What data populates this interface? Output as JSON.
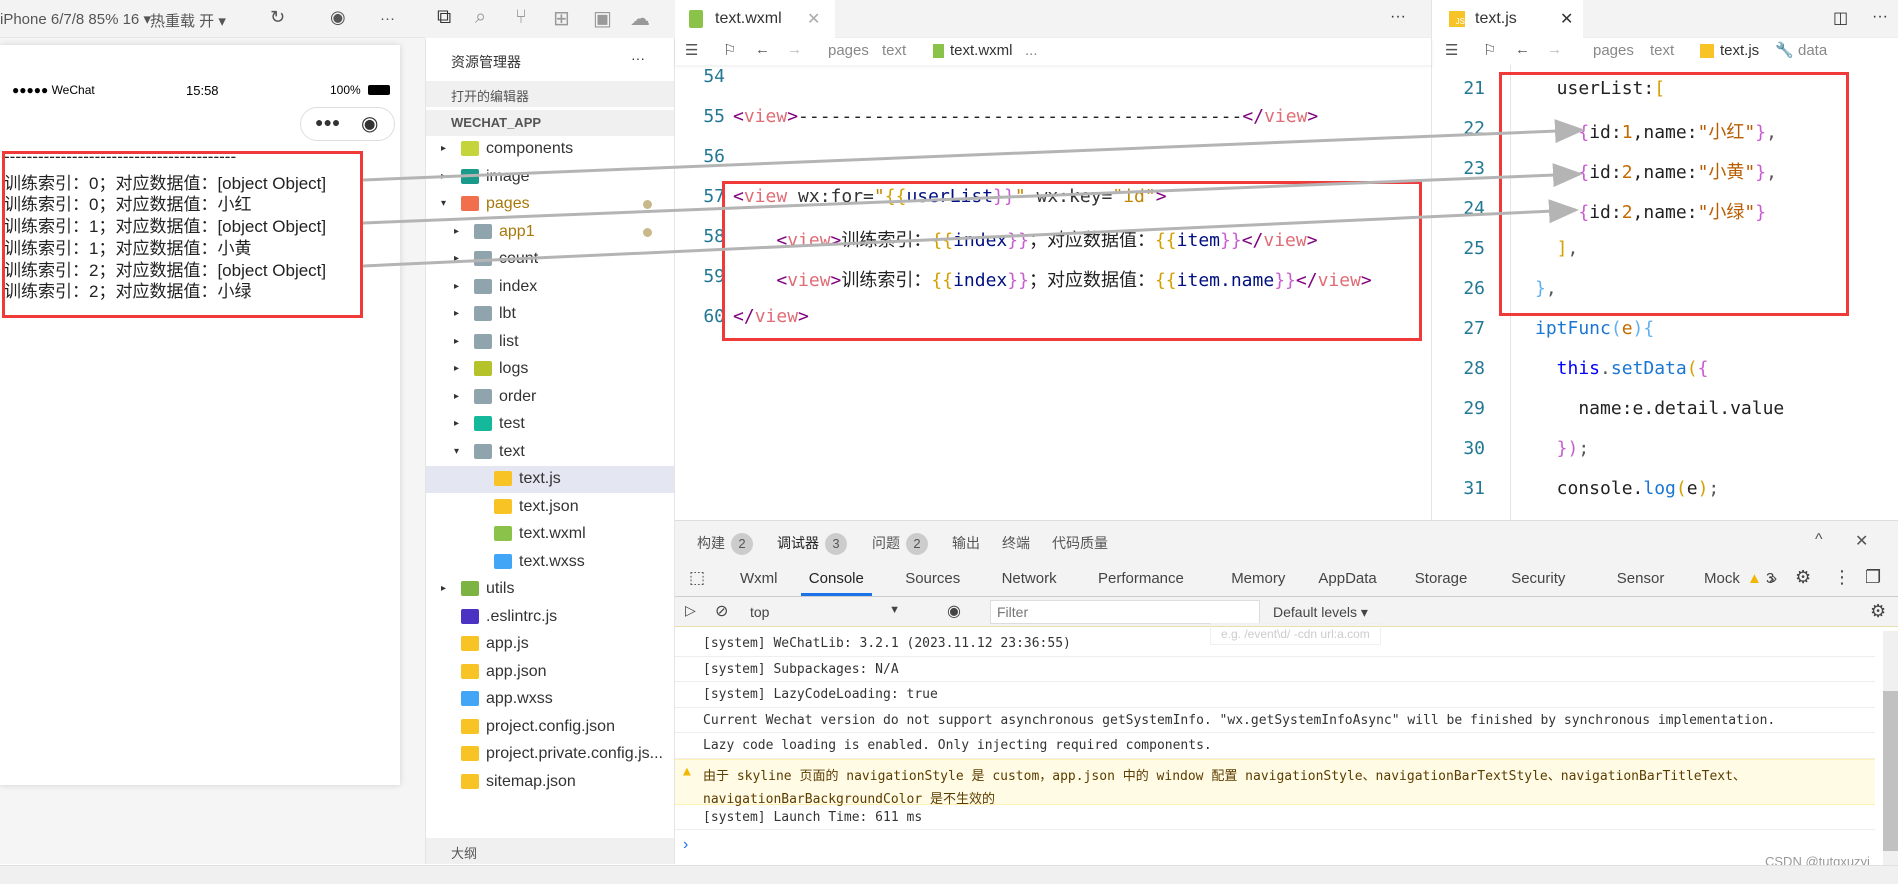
{
  "simulator": {
    "device": "iPhone 6/7/8 85% 16 ▾",
    "hot_reload": "热重载 开 ▾",
    "status": {
      "carrier": "●●●●● WeChat",
      "time": "15:58",
      "battery": "100%"
    },
    "lines": [
      "-----------------------------------------",
      "训练索引：0；对应数据值：[object Object]",
      "训练索引：0；对应数据值：小红",
      "训练索引：1；对应数据值：[object Object]",
      "训练索引：1；对应数据值：小黄",
      "训练索引：2；对应数据值：[object Object]",
      "训练索引：2；对应数据值：小绿"
    ]
  },
  "explorer": {
    "title": "资源管理器",
    "more": "···",
    "open_editors": "打开的编辑器",
    "project": "WECHAT_APP",
    "outline": "大纲",
    "items": [
      {
        "label": "components",
        "depth": 0,
        "arrow": "▸",
        "icon": "folder-components",
        "color": "#c6d43c"
      },
      {
        "label": "image",
        "depth": 0,
        "arrow": "▸",
        "icon": "folder-image",
        "color": "#1a9a8a"
      },
      {
        "label": "pages",
        "depth": 0,
        "arrow": "▾",
        "icon": "folder-pages",
        "color": "#f26f4d",
        "modified": true,
        "labelColor": "#a8780a"
      },
      {
        "label": "app1",
        "depth": 1,
        "arrow": "▸",
        "icon": "folder",
        "color": "#90a4ae",
        "modified": true,
        "labelColor": "#a8780a"
      },
      {
        "label": "count",
        "depth": 1,
        "arrow": "▸",
        "icon": "folder",
        "color": "#90a4ae"
      },
      {
        "label": "index",
        "depth": 1,
        "arrow": "▸",
        "icon": "folder",
        "color": "#90a4ae"
      },
      {
        "label": "lbt",
        "depth": 1,
        "arrow": "▸",
        "icon": "folder",
        "color": "#90a4ae"
      },
      {
        "label": "list",
        "depth": 1,
        "arrow": "▸",
        "icon": "folder",
        "color": "#90a4ae"
      },
      {
        "label": "logs",
        "depth": 1,
        "arrow": "▸",
        "icon": "folder-logs",
        "color": "#b5c22a"
      },
      {
        "label": "order",
        "depth": 1,
        "arrow": "▸",
        "icon": "folder",
        "color": "#90a4ae"
      },
      {
        "label": "test",
        "depth": 1,
        "arrow": "▸",
        "icon": "folder-test",
        "color": "#14b89a"
      },
      {
        "label": "text",
        "depth": 1,
        "arrow": "▾",
        "icon": "folder-open",
        "color": "#90a4ae"
      },
      {
        "label": "text.js",
        "depth": 2,
        "icon": "js-file",
        "color": "#f7c325",
        "selected": true
      },
      {
        "label": "text.json",
        "depth": 2,
        "icon": "json-file",
        "color": "#f7c325"
      },
      {
        "label": "text.wxml",
        "depth": 2,
        "icon": "wxml-file",
        "color": "#8bc34a"
      },
      {
        "label": "text.wxss",
        "depth": 2,
        "icon": "wxss-file",
        "color": "#42a5f5"
      },
      {
        "label": "utils",
        "depth": 0,
        "arrow": "▸",
        "icon": "folder-utils",
        "color": "#7cb342"
      },
      {
        "label": ".eslintrc.js",
        "depth": 0,
        "icon": "eslint-file",
        "color": "#4b32c3"
      },
      {
        "label": "app.js",
        "depth": 0,
        "icon": "js-file",
        "color": "#f7c325"
      },
      {
        "label": "app.json",
        "depth": 0,
        "icon": "json-file",
        "color": "#f7c325"
      },
      {
        "label": "app.wxss",
        "depth": 0,
        "icon": "wxss-file",
        "color": "#42a5f5"
      },
      {
        "label": "project.config.json",
        "depth": 0,
        "icon": "json-file",
        "color": "#f7c325"
      },
      {
        "label": "project.private.config.js...",
        "depth": 0,
        "icon": "json-file",
        "color": "#f7c325"
      },
      {
        "label": "sitemap.json",
        "depth": 0,
        "icon": "json-file",
        "color": "#f7c325"
      }
    ]
  },
  "editor1": {
    "tab": "text.wxml",
    "crumbs": [
      "pages",
      "text",
      "text.wxml",
      "..."
    ],
    "lines": [
      {
        "n": "54",
        "tokens": []
      },
      {
        "n": "55",
        "tokens": [
          {
            "t": "<",
            "c": "tag"
          },
          {
            "t": "view",
            "c": "tn"
          },
          {
            "t": ">",
            "c": "tag"
          },
          {
            "t": "-----------------------------------------",
            "c": "txt"
          },
          {
            "t": "</",
            "c": "tag"
          },
          {
            "t": "view",
            "c": "tn"
          },
          {
            "t": ">",
            "c": "tag"
          }
        ]
      },
      {
        "n": "56",
        "tokens": []
      },
      {
        "n": "57",
        "tokens": [
          {
            "t": "<",
            "c": "tag"
          },
          {
            "t": "view",
            "c": "tn"
          },
          {
            "t": " wx:for=",
            "c": "at"
          },
          {
            "t": "\"",
            "c": "str"
          },
          {
            "t": "{{",
            "c": "br"
          },
          {
            "t": "userList",
            "c": "id"
          },
          {
            "t": "}}",
            "c": "br2"
          },
          {
            "t": "\"",
            "c": "str"
          },
          {
            "t": " wx:key=",
            "c": "at"
          },
          {
            "t": "\"id\"",
            "c": "str"
          },
          {
            "t": ">",
            "c": "tag"
          }
        ]
      },
      {
        "n": "58",
        "tokens": [
          {
            "t": "    <",
            "c": "tag"
          },
          {
            "t": "view",
            "c": "tn"
          },
          {
            "t": ">",
            "c": "tag"
          },
          {
            "t": "训练索引：",
            "c": "txt"
          },
          {
            "t": "{{",
            "c": "br"
          },
          {
            "t": "index",
            "c": "id"
          },
          {
            "t": "}}",
            "c": "br2"
          },
          {
            "t": "；对应数据值：",
            "c": "txt"
          },
          {
            "t": "{{",
            "c": "br"
          },
          {
            "t": "item",
            "c": "id"
          },
          {
            "t": "}}",
            "c": "br2"
          },
          {
            "t": "</",
            "c": "tag"
          },
          {
            "t": "view",
            "c": "tn"
          },
          {
            "t": ">",
            "c": "tag"
          }
        ]
      },
      {
        "n": "59",
        "tokens": [
          {
            "t": "    <",
            "c": "tag"
          },
          {
            "t": "view",
            "c": "tn"
          },
          {
            "t": ">",
            "c": "tag"
          },
          {
            "t": "训练索引：",
            "c": "txt"
          },
          {
            "t": "{{",
            "c": "br"
          },
          {
            "t": "index",
            "c": "id"
          },
          {
            "t": "}}",
            "c": "br2"
          },
          {
            "t": "；对应数据值：",
            "c": "txt"
          },
          {
            "t": "{{",
            "c": "br"
          },
          {
            "t": "item.name",
            "c": "id"
          },
          {
            "t": "}}",
            "c": "br2"
          },
          {
            "t": "</",
            "c": "tag"
          },
          {
            "t": "view",
            "c": "tn"
          },
          {
            "t": ">",
            "c": "tag"
          }
        ]
      },
      {
        "n": "60",
        "tokens": [
          {
            "t": "</",
            "c": "tag"
          },
          {
            "t": "view",
            "c": "tn"
          },
          {
            "t": ">",
            "c": "tag"
          }
        ]
      }
    ]
  },
  "editor2": {
    "tab": "text.js",
    "crumbs": [
      "pages",
      "text",
      "text.js",
      "data"
    ],
    "lines": [
      {
        "n": "21",
        "tokens": [
          {
            "t": "  userList:",
            "c": "txt"
          },
          {
            "t": "[",
            "c": "br"
          }
        ]
      },
      {
        "n": "22",
        "tokens": [
          {
            "t": "    {",
            "c": "br2"
          },
          {
            "t": "id:",
            "c": "txt"
          },
          {
            "t": "1",
            "c": "num"
          },
          {
            "t": ",name:",
            "c": "txt"
          },
          {
            "t": "\"小红\"",
            "c": "cn"
          },
          {
            "t": "}",
            "c": "br2"
          },
          {
            "t": ",",
            "c": "p"
          }
        ]
      },
      {
        "n": "23",
        "tokens": [
          {
            "t": "    {",
            "c": "br2"
          },
          {
            "t": "id:",
            "c": "txt"
          },
          {
            "t": "2",
            "c": "num"
          },
          {
            "t": ",name:",
            "c": "txt"
          },
          {
            "t": "\"小黄\"",
            "c": "cn"
          },
          {
            "t": "}",
            "c": "br2"
          },
          {
            "t": ",",
            "c": "p"
          }
        ]
      },
      {
        "n": "24",
        "tokens": [
          {
            "t": "    {",
            "c": "br2"
          },
          {
            "t": "id:",
            "c": "txt"
          },
          {
            "t": "2",
            "c": "num"
          },
          {
            "t": ",name:",
            "c": "txt"
          },
          {
            "t": "\"小绿\"",
            "c": "cn"
          },
          {
            "t": "}",
            "c": "br2"
          }
        ]
      },
      {
        "n": "25",
        "tokens": [
          {
            "t": "  ]",
            "c": "br"
          },
          {
            "t": ",",
            "c": "p"
          }
        ]
      },
      {
        "n": "26",
        "tokens": [
          {
            "t": "}",
            "c": "br3"
          },
          {
            "t": ",",
            "c": "p"
          }
        ]
      },
      {
        "n": "27",
        "tokens": [
          {
            "t": "iptFunc",
            "c": "fn"
          },
          {
            "t": "(",
            "c": "br3"
          },
          {
            "t": "e",
            "c": "num"
          },
          {
            "t": "){",
            "c": "br3"
          }
        ]
      },
      {
        "n": "28",
        "tokens": [
          {
            "t": "  this",
            "c": "kw"
          },
          {
            "t": ".",
            "c": "p"
          },
          {
            "t": "setData",
            "c": "fn"
          },
          {
            "t": "(",
            "c": "br"
          },
          {
            "t": "{",
            "c": "br2"
          }
        ]
      },
      {
        "n": "29",
        "tokens": [
          {
            "t": "    name:e.detail.value",
            "c": "txt"
          }
        ]
      },
      {
        "n": "30",
        "tokens": [
          {
            "t": "  })",
            "c": "br2"
          },
          {
            "t": ";",
            "c": "p"
          }
        ]
      },
      {
        "n": "31",
        "tokens": [
          {
            "t": "  console.",
            "c": "txt"
          },
          {
            "t": "log",
            "c": "fn"
          },
          {
            "t": "(",
            "c": "br"
          },
          {
            "t": "e",
            "c": "txt"
          },
          {
            "t": ")",
            "c": "br"
          },
          {
            "t": ";",
            "c": "p"
          }
        ]
      }
    ]
  },
  "panel": {
    "tabs": [
      {
        "label": "构建",
        "badge": "2"
      },
      {
        "label": "调试器",
        "badge": "3",
        "active": true
      },
      {
        "label": "问题",
        "badge": "2"
      },
      {
        "label": "输出"
      },
      {
        "label": "终端"
      },
      {
        "label": "代码质量"
      }
    ],
    "devtabs": [
      "Wxml",
      "Console",
      "Sources",
      "Network",
      "Performance",
      "Memory",
      "AppData",
      "Storage",
      "Security",
      "Sensor",
      "Mock"
    ],
    "active_devtab": "Console",
    "more": "»",
    "warn_count": "3",
    "context": "top",
    "filter_placeholder": "Filter",
    "levels": "Default levels ▾",
    "filter_hint": "e.g. /event\\d/ -cdn url:a.com",
    "logs": [
      {
        "text": "[system] WeChatLib: 3.2.1 (2023.11.12 23:36:55)"
      },
      {
        "text": "[system] Subpackages: N/A"
      },
      {
        "text": "[system] LazyCodeLoading: true"
      },
      {
        "text": "Current Wechat version do not support asynchronous getSystemInfo. \"wx.getSystemInfoAsync\" will be finished by synchronous implementation."
      },
      {
        "text": "Lazy code loading is enabled. Only injecting required components."
      },
      {
        "text": "由于 skyline 页面的 navigationStyle 是 custom，app.json 中的 window 配置 navigationStyle、navigationBarTextStyle、navigationBarTitleText、",
        "text2": "navigationBarBackgroundColor 是不生效的",
        "level": "warning"
      },
      {
        "text": "[system] Launch Time: 611 ms"
      }
    ],
    "prompt": "›"
  },
  "watermark": "CSDN @tutgxuzyj",
  "colors": {
    "highlight": "#f03a3a",
    "arrow": "#b4b4b4",
    "active_tab": "#1a73e8"
  }
}
